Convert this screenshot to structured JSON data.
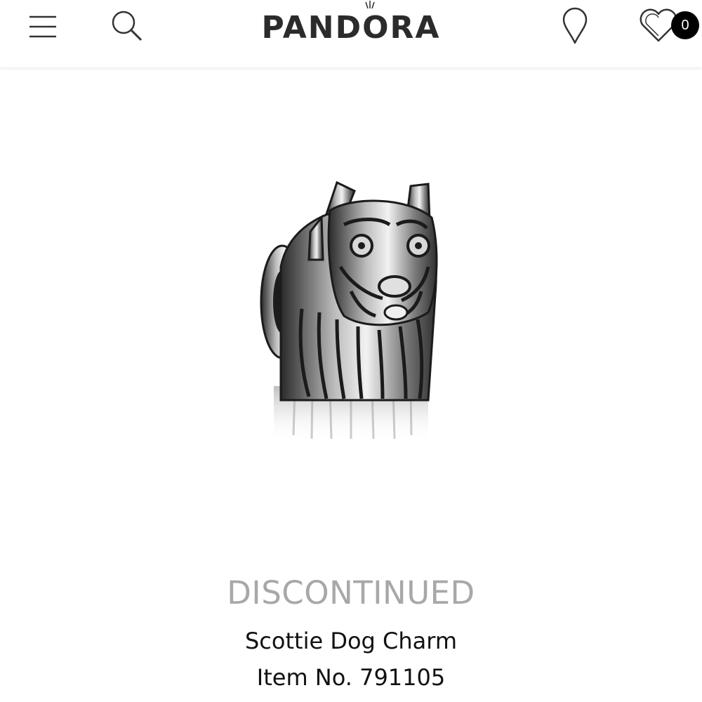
{
  "header": {
    "logo": "PANDORA",
    "icons": {
      "menu": "hamburger-menu-icon",
      "search": "search-icon",
      "store_locator": "location-pin-icon",
      "wishlist": "heart-icon"
    },
    "wishlist_count": "0"
  },
  "product": {
    "image": "scottie-dog-charm-image",
    "status": "DISCONTINUED",
    "name": "Scottie Dog Charm",
    "item_number": "Item No. 791105"
  },
  "colors": {
    "status_text": "#a8a8a8",
    "badge_bg": "#000000",
    "text": "#111111"
  }
}
